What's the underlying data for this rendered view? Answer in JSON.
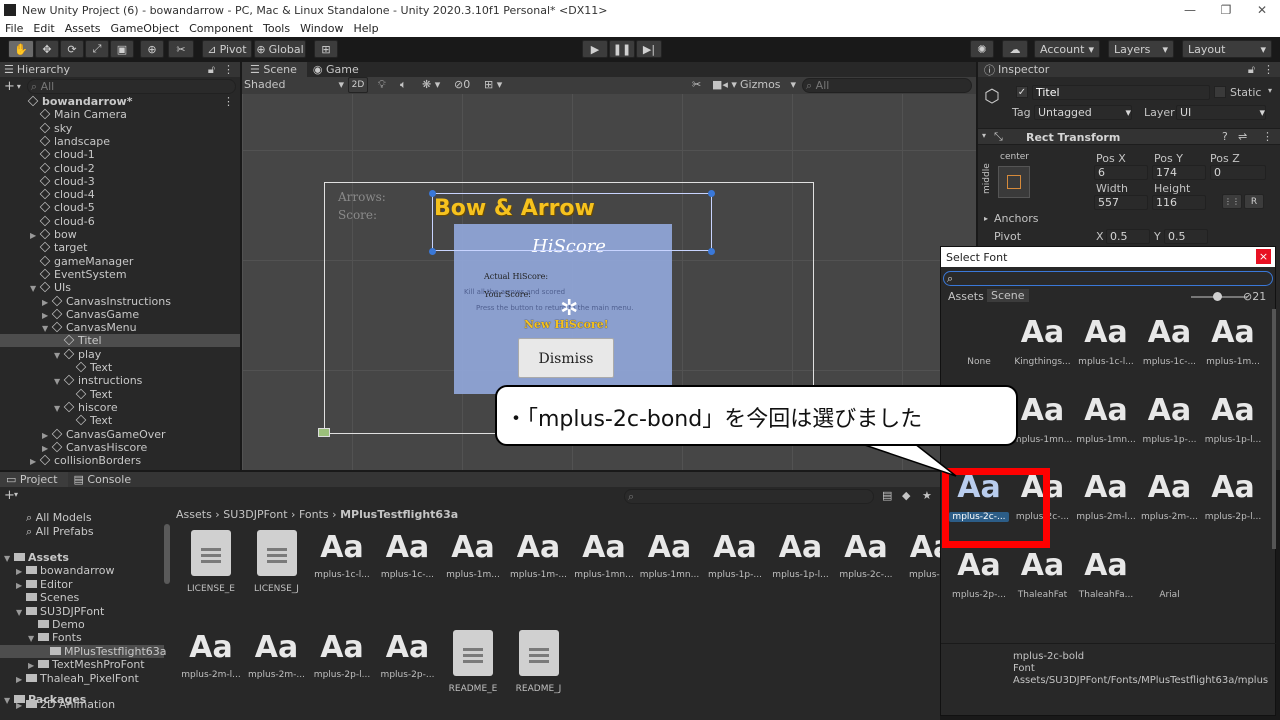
{
  "window": {
    "title": "New Unity Project (6) - bowandarrow - PC, Mac & Linux Standalone - Unity 2020.3.10f1 Personal* <DX11>"
  },
  "menu": [
    "File",
    "Edit",
    "Assets",
    "GameObject",
    "Component",
    "Tools",
    "Window",
    "Help"
  ],
  "toolbar": {
    "pivot": "Pivot",
    "global": "Global",
    "account": "Account",
    "layers": "Layers",
    "layout": "Layout"
  },
  "hierarchy": {
    "tab": "Hierarchy",
    "search": "All",
    "items": [
      {
        "label": "bowandarrow*",
        "depth": 0,
        "icon": "scene",
        "bold": true
      },
      {
        "label": "Main Camera",
        "depth": 1
      },
      {
        "label": "sky",
        "depth": 1
      },
      {
        "label": "landscape",
        "depth": 1
      },
      {
        "label": "cloud-1",
        "depth": 1
      },
      {
        "label": "cloud-2",
        "depth": 1
      },
      {
        "label": "cloud-3",
        "depth": 1
      },
      {
        "label": "cloud-4",
        "depth": 1
      },
      {
        "label": "cloud-5",
        "depth": 1
      },
      {
        "label": "cloud-6",
        "depth": 1
      },
      {
        "label": "bow",
        "depth": 1,
        "arrow": "right"
      },
      {
        "label": "target",
        "depth": 1
      },
      {
        "label": "gameManager",
        "depth": 1
      },
      {
        "label": "EventSystem",
        "depth": 1
      },
      {
        "label": "UIs",
        "depth": 1,
        "arrow": "down"
      },
      {
        "label": "CanvasInstructions",
        "depth": 2,
        "arrow": "right"
      },
      {
        "label": "CanvasGame",
        "depth": 2,
        "arrow": "right"
      },
      {
        "label": "CanvasMenu",
        "depth": 2,
        "arrow": "down"
      },
      {
        "label": "Titel",
        "depth": 3,
        "selected": true
      },
      {
        "label": "play",
        "depth": 3,
        "arrow": "down"
      },
      {
        "label": "Text",
        "depth": 4
      },
      {
        "label": "instructions",
        "depth": 3,
        "arrow": "down"
      },
      {
        "label": "Text",
        "depth": 4
      },
      {
        "label": "hiscore",
        "depth": 3,
        "arrow": "down"
      },
      {
        "label": "Text",
        "depth": 4
      },
      {
        "label": "CanvasGameOver",
        "depth": 2,
        "arrow": "right"
      },
      {
        "label": "CanvasHiscore",
        "depth": 2,
        "arrow": "right"
      },
      {
        "label": "collisionBorders",
        "depth": 1,
        "arrow": "right"
      }
    ]
  },
  "scene": {
    "tabs": [
      "Scene",
      "Game"
    ],
    "shaded": "Shaded",
    "mode2d": "2D",
    "gizmos": "Gizmos",
    "search": "All",
    "hidden_count": "0",
    "game": {
      "arrows": "Arrows:",
      "score": "Score:",
      "title": "Bow & Arrow",
      "hiscore": "HiScore",
      "actual": "Actual HiScore:",
      "your": "Your Score:",
      "new": "New HiScore!",
      "dismiss": "Dismiss",
      "hint": "Kill all the arrows and scored",
      "hint2": "Press the button to return to the main menu."
    }
  },
  "inspector": {
    "tab": "Inspector",
    "name": "Titel",
    "static": "Static",
    "tag_label": "Tag",
    "tag": "Untagged",
    "layer_label": "Layer",
    "layer": "UI",
    "rect_transform": "Rect Transform",
    "anchor_h": "center",
    "anchor_v": "middle",
    "pos_x_label": "Pos X",
    "pos_y_label": "Pos Y",
    "pos_z_label": "Pos Z",
    "pos_x": "6",
    "pos_y": "174",
    "pos_z": "0",
    "width_label": "Width",
    "height_label": "Height",
    "width": "557",
    "height": "116",
    "anchors": "Anchors",
    "pivot": "Pivot",
    "pivot_x_label": "X",
    "pivot_x": "0.5",
    "pivot_y_label": "Y",
    "pivot_y": "0.5",
    "r_button": "R"
  },
  "select_font": {
    "title": "Select Font",
    "close": "×",
    "tab_assets": "Assets",
    "tab_scene": "Scene",
    "hidden_count": "21",
    "fonts": [
      {
        "name": "None",
        "none": true
      },
      {
        "name": "Kingthings..."
      },
      {
        "name": "mplus-1c-l..."
      },
      {
        "name": "mplus-1c-..."
      },
      {
        "name": "mplus-1m..."
      },
      {
        "name": "mplus-1m-..."
      },
      {
        "name": "mplus-1mn..."
      },
      {
        "name": "mplus-1mn..."
      },
      {
        "name": "mplus-1p-..."
      },
      {
        "name": "mplus-1p-l..."
      },
      {
        "name": "mplus-2c-...",
        "selected": true
      },
      {
        "name": "mplus-2c-..."
      },
      {
        "name": "mplus-2m-l..."
      },
      {
        "name": "mplus-2m-..."
      },
      {
        "name": "mplus-2p-l..."
      },
      {
        "name": "mplus-2p-..."
      },
      {
        "name": "ThaleahFat"
      },
      {
        "name": "ThaleahFa..."
      },
      {
        "name": "Arial",
        "none": true
      }
    ],
    "info_name": "mplus-2c-bold",
    "info_type": "Font",
    "info_path": "Assets/SU3DJPFont/Fonts/MPlusTestflight63a/mplus"
  },
  "callout": {
    "text": "・「mplus-2c-bond」を今回は選びました"
  },
  "project": {
    "tabs": [
      "Project",
      "Console"
    ],
    "favorites": [
      "All Models",
      "All Prefabs"
    ],
    "tree": [
      {
        "label": "Assets",
        "depth": 0,
        "arrow": "down",
        "bold": true
      },
      {
        "label": "bowandarrow",
        "depth": 1,
        "arrow": "right"
      },
      {
        "label": "Editor",
        "depth": 1,
        "arrow": "right"
      },
      {
        "label": "Scenes",
        "depth": 1
      },
      {
        "label": "SU3DJPFont",
        "depth": 1,
        "arrow": "down"
      },
      {
        "label": "Demo",
        "depth": 2
      },
      {
        "label": "Fonts",
        "depth": 2,
        "arrow": "down"
      },
      {
        "label": "MPlusTestflight63a",
        "depth": 3,
        "selected": true
      },
      {
        "label": "TextMeshProFont",
        "depth": 2,
        "arrow": "right"
      },
      {
        "label": "Thaleah_PixelFont",
        "depth": 1,
        "arrow": "right"
      },
      {
        "label": "Packages",
        "depth": 0,
        "arrow": "down",
        "bold": true
      },
      {
        "label": "2D Animation",
        "depth": 1,
        "arrow": "right"
      }
    ],
    "breadcrumb": [
      "Assets",
      "SU3DJPFont",
      "Fonts",
      "MPlusTestflight63a"
    ],
    "assets": [
      {
        "name": "LICENSE_E",
        "doc": true
      },
      {
        "name": "LICENSE_J",
        "doc": true
      },
      {
        "name": "mplus-1c-l..."
      },
      {
        "name": "mplus-1c-..."
      },
      {
        "name": "mplus-1m..."
      },
      {
        "name": "mplus-1m-..."
      },
      {
        "name": "mplus-1mn..."
      },
      {
        "name": "mplus-1mn..."
      },
      {
        "name": "mplus-1p-..."
      },
      {
        "name": "mplus-1p-l..."
      },
      {
        "name": "mplus-2c-..."
      },
      {
        "name": "mplus-2..."
      },
      {
        "name": "mplus-2m-l..."
      },
      {
        "name": "mplus-2m-..."
      },
      {
        "name": "mplus-2p-l..."
      },
      {
        "name": "mplus-2p-..."
      },
      {
        "name": "README_E",
        "doc": true
      },
      {
        "name": "README_J",
        "doc": true
      }
    ],
    "glyph": "Aa"
  },
  "colors": {
    "accent": "#2c5d87",
    "highlight": "#ff0000",
    "title_gold": "#f6c21e"
  }
}
